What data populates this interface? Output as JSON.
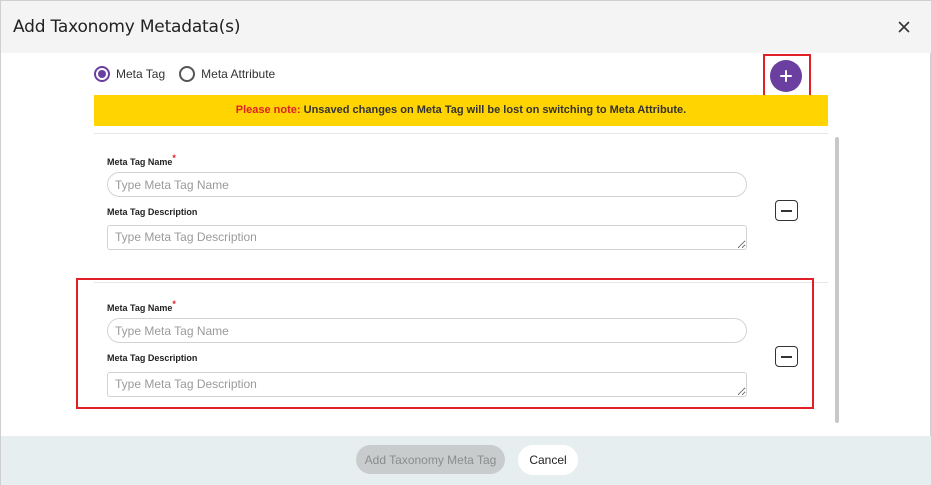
{
  "dialog": {
    "title": "Add Taxonomy Metadata(s)"
  },
  "radio_group": {
    "options": [
      {
        "label": "Meta Tag",
        "selected": true
      },
      {
        "label": "Meta Attribute",
        "selected": false
      }
    ]
  },
  "notice": {
    "label": "Please note:",
    "text": " Unsaved changes on Meta Tag will be lost on switching to Meta Attribute."
  },
  "entries": [
    {
      "name_label": "Meta Tag Name",
      "required_mark": "*",
      "name_placeholder": "Type Meta Tag Name",
      "name_value": "",
      "description_label": "Meta Tag Description",
      "description_placeholder": "Type Meta Tag Description",
      "description_value": ""
    },
    {
      "name_label": "Meta Tag Name",
      "required_mark": "*",
      "name_placeholder": "Type Meta Tag Name",
      "name_value": "",
      "description_label": "Meta Tag Description",
      "description_placeholder": "Type Meta Tag Description",
      "description_value": ""
    }
  ],
  "footer": {
    "submit_label": "Add Taxonomy Meta Tag",
    "cancel_label": "Cancel"
  },
  "icons": {
    "close": "close-icon",
    "add": "plus-icon",
    "remove": "minus-icon"
  },
  "colors": {
    "accent": "#6b3fa0",
    "notice_bg": "#ffd400",
    "notice_label": "#e01f26",
    "highlight_border": "#e01f26",
    "footer_bg": "#e7eef0"
  }
}
